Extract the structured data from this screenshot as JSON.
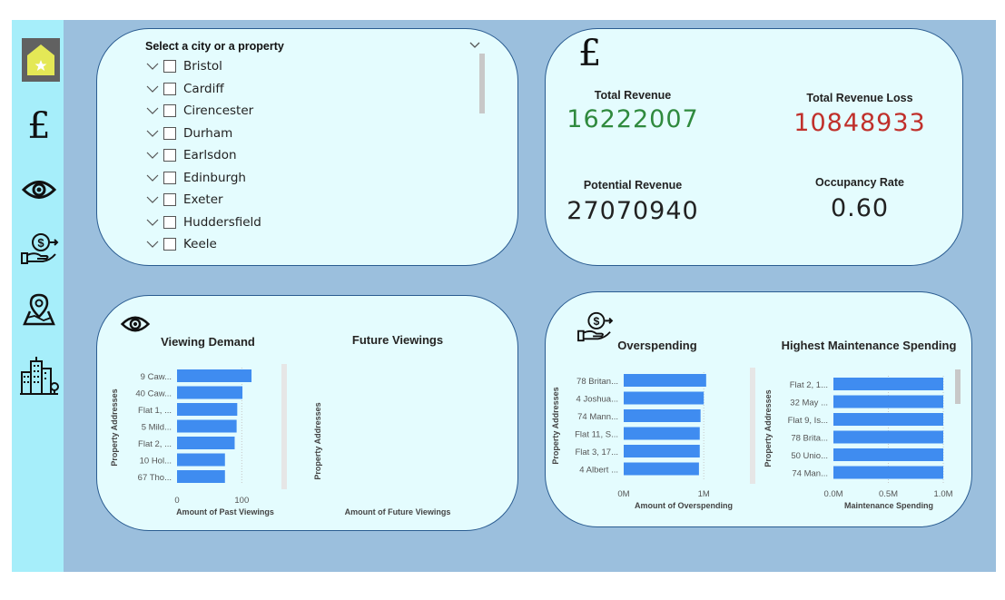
{
  "nav": {
    "items": [
      {
        "name": "home-icon",
        "icon": "home-star",
        "active": true
      },
      {
        "name": "pound-icon",
        "icon": "pound"
      },
      {
        "name": "eye-icon",
        "icon": "eye"
      },
      {
        "name": "money-hand-icon",
        "icon": "money-hand"
      },
      {
        "name": "map-pin-icon",
        "icon": "map-pin"
      },
      {
        "name": "city-icon",
        "icon": "city"
      }
    ],
    "pound_glyph": "£"
  },
  "slicer": {
    "title": "Select a city or a property",
    "items": [
      "Bristol",
      "Cardiff",
      "Cirencester",
      "Durham",
      "Earlsdon",
      "Edinburgh",
      "Exeter",
      "Huddersfield",
      "Keele"
    ]
  },
  "kpis": {
    "pound_glyph": "£",
    "total_revenue": {
      "label": "Total Revenue",
      "value": "16222007",
      "color": "#2f8a3e"
    },
    "total_revenue_loss": {
      "label": "Total Revenue Loss",
      "value": "10848933",
      "color": "#c0302b"
    },
    "potential_revenue": {
      "label": "Potential Revenue",
      "value": "27070940",
      "color": "#222222"
    },
    "occupancy_rate": {
      "label": "Occupancy Rate",
      "value": "0.60",
      "color": "#222222"
    }
  },
  "colors": {
    "bar": "#3f8cf0",
    "accent": "#2a5c91"
  },
  "chart_data": [
    {
      "type": "bar",
      "orientation": "horizontal",
      "title": "Viewing Demand",
      "xlabel": "Amount of Past Viewings",
      "ylabel": "Property Addresses",
      "categories": [
        "9 Caw...",
        "40 Caw...",
        "Flat 1, ...",
        "5 Mild...",
        "Flat 2, ...",
        "10 Hol...",
        "67 Tho..."
      ],
      "values": [
        115,
        101,
        93,
        92,
        89,
        74,
        74
      ],
      "xlim": [
        0,
        150
      ],
      "xticks": [
        0,
        100
      ],
      "xtick_labels": [
        "0",
        "100"
      ]
    },
    {
      "type": "bar",
      "orientation": "horizontal",
      "title": "Future Viewings",
      "xlabel": "Amount of Future Viewings",
      "ylabel": "Property Addresses",
      "categories": [],
      "values": []
    },
    {
      "type": "bar",
      "orientation": "horizontal",
      "title": "Overspending",
      "xlabel": "Amount of Overspending",
      "ylabel": "Property Addresses",
      "categories": [
        "78 Britan...",
        "4 Joshua...",
        "74 Mann...",
        "Flat 11, S...",
        "Flat 3, 17...",
        "4 Albert ..."
      ],
      "values": [
        1030000,
        1000000,
        960000,
        950000,
        950000,
        940000
      ],
      "xlim": [
        0,
        1100000
      ],
      "xticks": [
        0,
        1000000
      ],
      "xtick_labels": [
        "0M",
        "1M"
      ]
    },
    {
      "type": "bar",
      "orientation": "horizontal",
      "title": "Highest Maintenance Spending",
      "xlabel": "Maintenance Spending",
      "ylabel": "Property Addresses",
      "categories": [
        "Flat 2, 1...",
        "32 May ...",
        "Flat 9, Is...",
        "78 Brita...",
        "50 Unio...",
        "74 Man..."
      ],
      "values": [
        1000000,
        1000000,
        1000000,
        1000000,
        1000000,
        1000000
      ],
      "xlim": [
        0,
        1000000
      ],
      "xticks": [
        0,
        500000,
        1000000
      ],
      "xtick_labels": [
        "0.0M",
        "0.5M",
        "1.0M"
      ]
    }
  ]
}
